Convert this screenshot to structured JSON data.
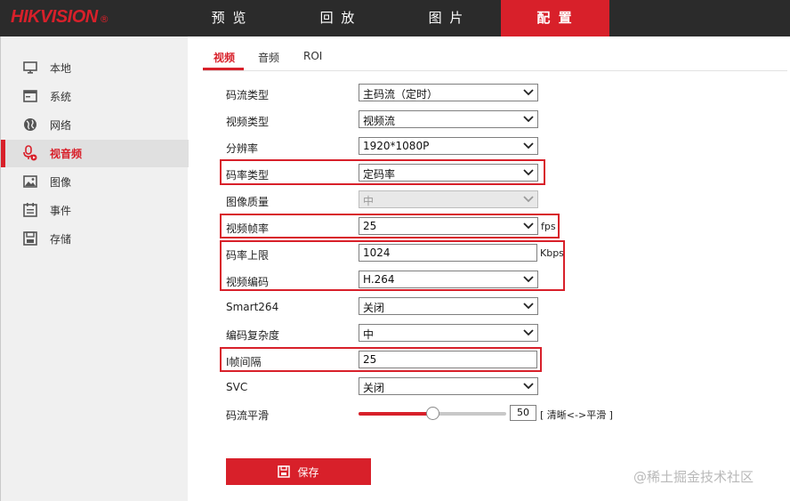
{
  "brand": {
    "name": "HIKVISION",
    "mark": "®"
  },
  "nav": {
    "items": [
      "预 览",
      "回 放",
      "图 片",
      "配 置"
    ],
    "active": 3
  },
  "sidebar": {
    "items": [
      {
        "label": "本地",
        "icon": "monitor-icon"
      },
      {
        "label": "系统",
        "icon": "system-window-icon"
      },
      {
        "label": "网络",
        "icon": "globe-icon"
      },
      {
        "label": "视音频",
        "icon": "microphone-icon"
      },
      {
        "label": "图像",
        "icon": "image-icon"
      },
      {
        "label": "事件",
        "icon": "calendar-icon"
      },
      {
        "label": "存储",
        "icon": "disk-icon"
      }
    ],
    "active": 3
  },
  "tabs": {
    "items": [
      "视频",
      "音频",
      "ROI"
    ],
    "active": 0
  },
  "form": {
    "stream_type": {
      "label": "码流类型",
      "value": "主码流（定时）"
    },
    "video_type": {
      "label": "视频类型",
      "value": "视频流"
    },
    "resolution": {
      "label": "分辨率",
      "value": "1920*1080P"
    },
    "bitrate_type": {
      "label": "码率类型",
      "value": "定码率"
    },
    "image_quality": {
      "label": "图像质量",
      "value": "中"
    },
    "frame_rate": {
      "label": "视频帧率",
      "value": "25",
      "unit": "fps"
    },
    "max_bitrate": {
      "label": "码率上限",
      "value": "1024",
      "unit": "Kbps"
    },
    "video_encoding": {
      "label": "视频编码",
      "value": "H.264"
    },
    "smart264": {
      "label": "Smart264",
      "value": "关闭"
    },
    "encoding_complexity": {
      "label": "编码复杂度",
      "value": "中"
    },
    "i_frame_interval": {
      "label": "I帧间隔",
      "value": "25"
    },
    "svc": {
      "label": "SVC",
      "value": "关闭"
    },
    "stream_smoothing": {
      "label": "码流平滑",
      "value": "50",
      "hint": "[ 清晰<->平滑 ]",
      "level_percent": 50
    }
  },
  "save": {
    "label": "保存",
    "icon": "save-icon"
  },
  "watermark": "@稀土掘金技术社区",
  "colors": {
    "accent": "#d8202a",
    "topbar": "#2b2b2b",
    "sidebar": "#f0f0f0"
  }
}
